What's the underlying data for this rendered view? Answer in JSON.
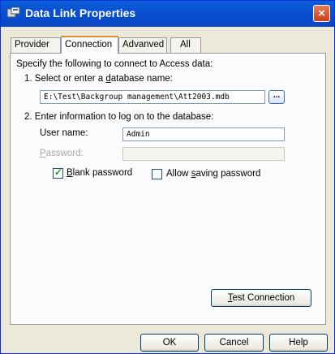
{
  "window": {
    "title": "Data Link Properties",
    "close_label": "×"
  },
  "tabs": [
    {
      "label": "Provider"
    },
    {
      "label": "Connection"
    },
    {
      "label": "Advanved"
    },
    {
      "label": "All"
    }
  ],
  "connection": {
    "intro": "Specify the following to connect to Access data:",
    "step1_prefix": "1. Select or enter a ",
    "step1_accel": "d",
    "step1_suffix": "atabase name:",
    "database_path": "E:\\Test\\Backgroup management\\Att2003.mdb",
    "browse_label": "...",
    "step2": "2. Enter information to log on to the database:",
    "username_label": "User name:",
    "username_value": "Admin",
    "password_accel": "P",
    "password_rest": "assword:",
    "password_value": "",
    "blank_accel": "B",
    "blank_rest": "lank password",
    "blank_checked": true,
    "allow_prefix": "Allow ",
    "allow_accel": "s",
    "allow_rest": "aving password",
    "allow_checked": false,
    "test_accel": "T",
    "test_rest": "est Connection"
  },
  "footer": {
    "ok": "OK",
    "cancel": "Cancel",
    "help": "Help"
  },
  "colors": {
    "titlebar": "#0a5fd8",
    "active_tab_highlight": "#e68b2c",
    "check": "#21a121"
  }
}
